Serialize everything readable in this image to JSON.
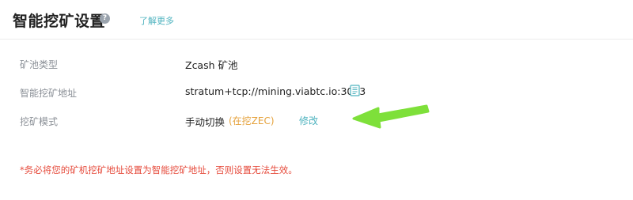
{
  "header": {
    "title": "智能挖矿设置",
    "help_icon_glyph": "?",
    "learn_more": "了解更多"
  },
  "settings": {
    "pool_type": {
      "label": "矿池类型",
      "value": "Zcash 矿池"
    },
    "address": {
      "label": "智能挖矿地址",
      "value": "stratum+tcp://mining.viabtc.io:3003",
      "icon": "copy-icon"
    },
    "mode": {
      "label": "挖矿模式",
      "value": "手动切换",
      "status": "(在挖ZEC)",
      "edit": "修改"
    }
  },
  "warning": "*务必将您的矿机挖矿地址设置为智能挖矿地址，否则设置无法生效。",
  "colors": {
    "accent": "#4fb3bf",
    "status": "#e5a23c",
    "warning": "#e64b3c",
    "arrow": "#7ee03a"
  }
}
